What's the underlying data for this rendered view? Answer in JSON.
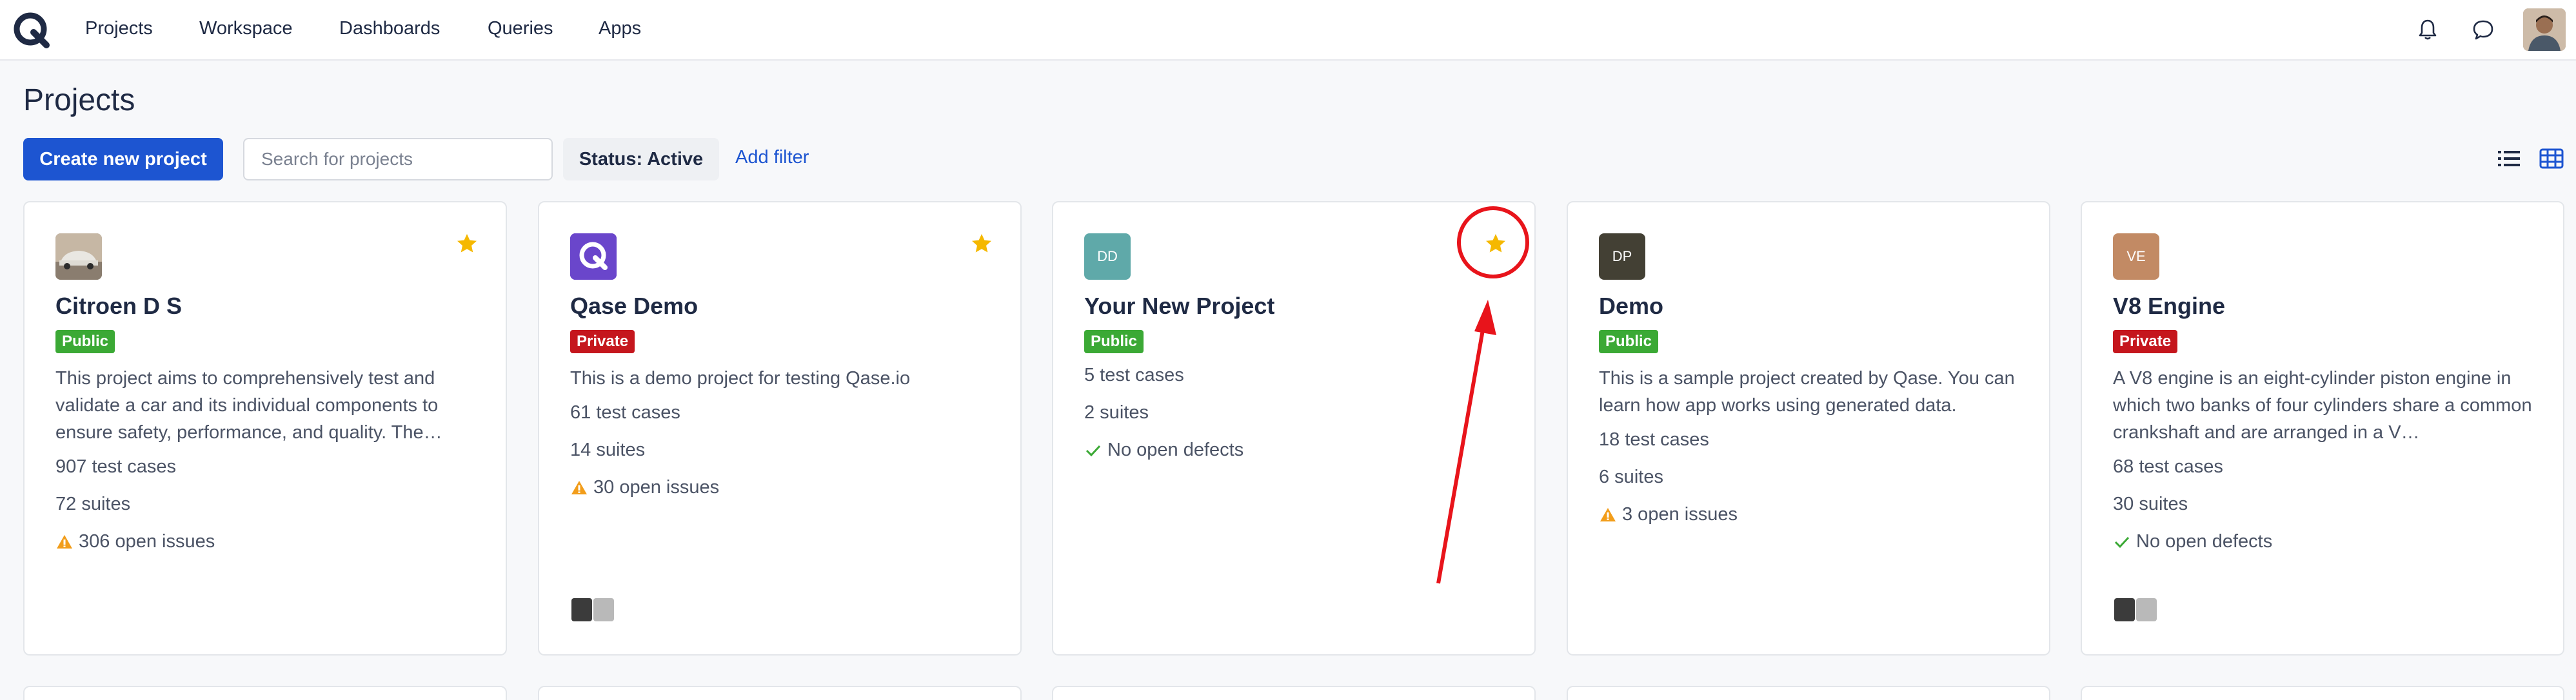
{
  "nav": {
    "items": [
      "Projects",
      "Workspace",
      "Dashboards",
      "Queries",
      "Apps"
    ]
  },
  "page": {
    "title": "Projects"
  },
  "toolbar": {
    "create_label": "Create new project",
    "search_placeholder": "Search for projects",
    "status_chip": "Status: Active",
    "add_filter": "Add filter"
  },
  "projects": [
    {
      "name": "Citroen D S",
      "visibility": "Public",
      "description": "This project aims to comprehensively test and validate a car and its individual components to ensure safety, performance, and quality. The…",
      "test_cases": "907 test cases",
      "suites": "72 suites",
      "issues": "306 open issues",
      "avatar_initials": "",
      "starred": true
    },
    {
      "name": "Qase Demo",
      "visibility": "Private",
      "description": "This is a demo project for testing Qase.io",
      "test_cases": "61 test cases",
      "suites": "14 suites",
      "issues": "30 open issues",
      "avatar_initials": "",
      "starred": true
    },
    {
      "name": "Your New Project",
      "visibility": "Public",
      "description": "",
      "test_cases": "5 test cases",
      "suites": "2 suites",
      "issues": "No open defects",
      "avatar_initials": "DD",
      "starred": true
    },
    {
      "name": "Demo",
      "visibility": "Public",
      "description": "This is a sample project created by Qase. You can learn how app works using generated data.",
      "test_cases": "18 test cases",
      "suites": "6 suites",
      "issues": "3 open issues",
      "avatar_initials": "DP",
      "starred": false
    },
    {
      "name": "V8 Engine",
      "visibility": "Private",
      "description": "A V8 engine is an eight-cylinder piston engine in which two banks of four cylinders share a common crankshaft and are arranged in a V…",
      "test_cases": "68 test cases",
      "suites": "30 suites",
      "issues": "No open defects",
      "avatar_initials": "VE",
      "starred": false
    }
  ],
  "colors": {
    "accent": "#1d55d1",
    "public": "#3ba935",
    "private": "#c5161d",
    "star": "#f5b800",
    "annotation": "#e8141b"
  },
  "icons": [
    "qase-logo-icon",
    "bell-icon",
    "chat-icon",
    "star-icon",
    "warning-icon",
    "check-icon",
    "list-view-icon",
    "grid-view-icon"
  ]
}
